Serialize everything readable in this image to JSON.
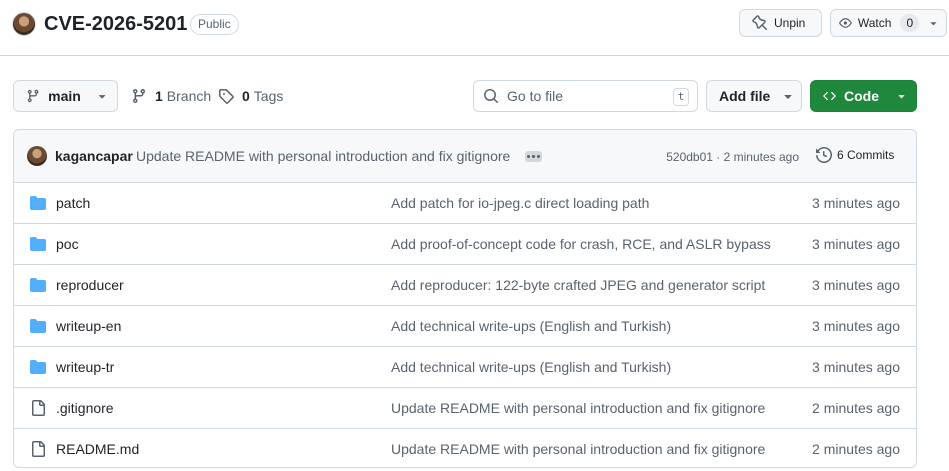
{
  "repo": {
    "name": "CVE-2026-5201",
    "visibility": "Public",
    "unpin_label": "Unpin",
    "watch_label": "Watch",
    "watch_count": "0"
  },
  "toolbar": {
    "branch": "main",
    "branches_count": "1",
    "branches_label": "Branch",
    "tags_count": "0",
    "tags_label": "Tags",
    "search_placeholder": "Go to file",
    "search_shortcut": "t",
    "add_file_label": "Add file",
    "code_label": "Code"
  },
  "latest_commit": {
    "author": "kagancapar",
    "message": "Update README with personal introduction and fix gitignore",
    "hash": "520db01",
    "time": "2 minutes ago",
    "meta": "520db01 · 2 minutes ago",
    "commits_label": "6 Commits"
  },
  "files": [
    {
      "name": "patch",
      "type": "folder",
      "message": "Add patch for io-jpeg.c direct loading path",
      "time": "3 minutes ago"
    },
    {
      "name": "poc",
      "type": "folder",
      "message": "Add proof-of-concept code for crash, RCE, and ASLR bypass",
      "time": "3 minutes ago"
    },
    {
      "name": "reproducer",
      "type": "folder",
      "message": "Add reproducer: 122-byte crafted JPEG and generator script",
      "time": "3 minutes ago"
    },
    {
      "name": "writeup-en",
      "type": "folder",
      "message": "Add technical write-ups (English and Turkish)",
      "time": "3 minutes ago"
    },
    {
      "name": "writeup-tr",
      "type": "folder",
      "message": "Add technical write-ups (English and Turkish)",
      "time": "3 minutes ago"
    },
    {
      "name": ".gitignore",
      "type": "file",
      "message": "Update README with personal introduction and fix gitignore",
      "time": "2 minutes ago"
    },
    {
      "name": "README.md",
      "type": "file",
      "message": "Update README with personal introduction and fix gitignore",
      "time": "2 minutes ago"
    }
  ],
  "colors": {
    "folder": "#54aeff",
    "file": "#59636e",
    "code_button": "#1f883d"
  }
}
